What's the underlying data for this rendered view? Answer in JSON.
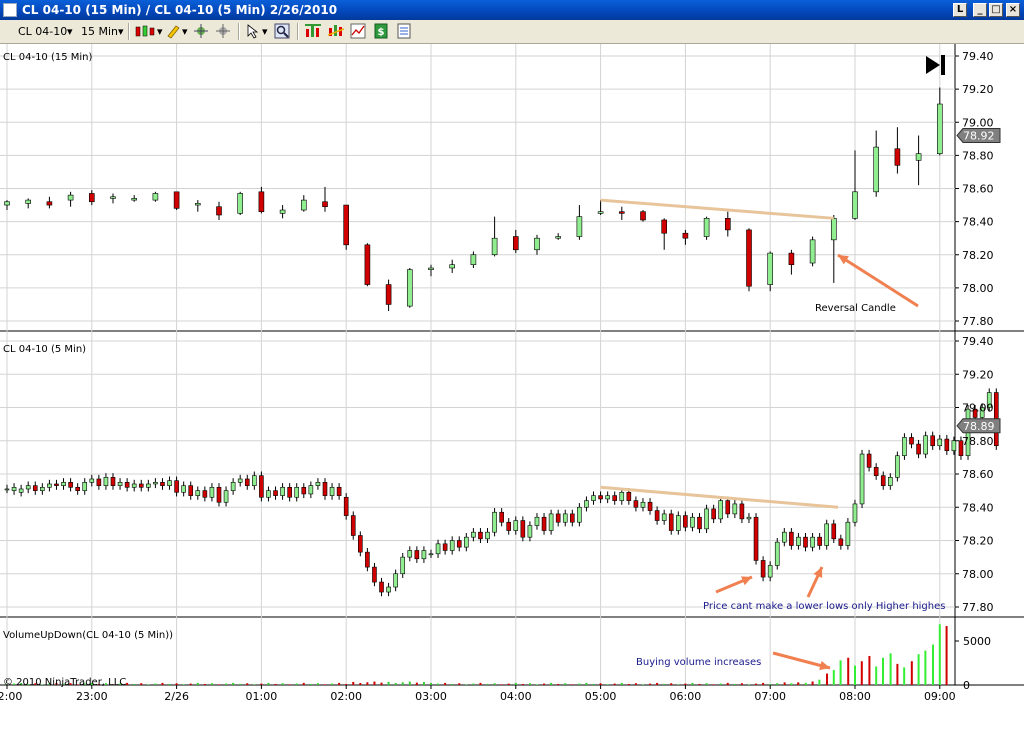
{
  "window": {
    "title": "CL 04-10 (15 Min) / CL 04-10 (5 Min)  2/26/2010",
    "buttons": [
      "L",
      "_",
      "□",
      "×"
    ]
  },
  "toolbar": {
    "instrument": "CL 04-10",
    "interval": "15 Min",
    "icons": [
      "candlestick-icon",
      "pencil-draw-icon",
      "crosshair-icon",
      "pointer-icon",
      "zoom-icon",
      "bar-chart-icon",
      "indicator-icon",
      "strategy-icon",
      "properties-icon"
    ]
  },
  "colors": {
    "up": "#90ee90",
    "down": "#d00000",
    "grid": "#d3d3d3",
    "trendline": "#e8c49a",
    "arrow": "#f08050",
    "annotation": "#1a1a8c",
    "price_marker_bg": "#808080"
  },
  "panels": {
    "p15": {
      "label": "CL 04-10 (15 Min)",
      "ylim": [
        77.75,
        79.45
      ],
      "ticks": [
        "79.40",
        "79.20",
        "79.00",
        "78.80",
        "78.60",
        "78.40",
        "78.20",
        "78.00",
        "77.80"
      ],
      "last_price": "78.92"
    },
    "p5": {
      "label": "CL 04-10 (5 Min)",
      "ylim": [
        77.75,
        79.45
      ],
      "ticks": [
        "79.40",
        "79.20",
        "79.00",
        "78.80",
        "78.60",
        "78.40",
        "78.20",
        "78.00",
        "77.80"
      ],
      "last_price": "78.89"
    },
    "vol": {
      "label": "VolumeUpDown(CL 04-10 (5 Min))",
      "ticks": [
        "5000",
        "0"
      ],
      "copyright": "© 2010 NinjaTrader, LLC"
    }
  },
  "time_axis": {
    "labels": [
      "2:00",
      "23:00",
      "2/26",
      "01:00",
      "02:00",
      "03:00",
      "04:00",
      "05:00",
      "06:00",
      "07:00",
      "08:00",
      "09:00"
    ],
    "hours": [
      -2,
      -1,
      0,
      1,
      2,
      3,
      4,
      5,
      6,
      7,
      8,
      9
    ]
  },
  "annotations": {
    "reversal": "Reversal Candle",
    "lower_lows": "Price cant make a lower lows only Higher highes",
    "volume": "Buying volume increases"
  },
  "chart_data": [
    {
      "type": "candlestick",
      "title": "CL 04-10 (15 Min)",
      "x_unit": "hours relative to 00:00 on 2/26 (x axis labels 2:00 ... 09:00)",
      "candles": [
        [
          -2.0,
          78.5,
          78.53,
          78.47,
          78.52
        ],
        [
          -1.75,
          78.51,
          78.54,
          78.48,
          78.53
        ],
        [
          -1.5,
          78.52,
          78.55,
          78.48,
          78.5
        ],
        [
          -1.25,
          78.53,
          78.58,
          78.49,
          78.56
        ],
        [
          -1.0,
          78.57,
          78.59,
          78.5,
          78.52
        ],
        [
          -0.75,
          78.54,
          78.57,
          78.51,
          78.55
        ],
        [
          -0.5,
          78.53,
          78.56,
          78.52,
          78.54
        ],
        [
          -0.25,
          78.53,
          78.58,
          78.52,
          78.57
        ],
        [
          0.0,
          78.58,
          78.58,
          78.47,
          78.48
        ],
        [
          0.25,
          78.5,
          78.53,
          78.46,
          78.51
        ],
        [
          0.5,
          78.49,
          78.52,
          78.41,
          78.44
        ],
        [
          0.75,
          78.45,
          78.58,
          78.44,
          78.57
        ],
        [
          1.0,
          78.58,
          78.61,
          78.45,
          78.46
        ],
        [
          1.25,
          78.45,
          78.5,
          78.42,
          78.47
        ],
        [
          1.5,
          78.47,
          78.56,
          78.46,
          78.53
        ],
        [
          1.75,
          78.52,
          78.61,
          78.46,
          78.49
        ],
        [
          2.0,
          78.5,
          78.5,
          78.23,
          78.26
        ],
        [
          2.25,
          78.26,
          78.27,
          78.01,
          78.02
        ],
        [
          2.5,
          78.02,
          78.05,
          77.86,
          77.9
        ],
        [
          2.75,
          77.89,
          78.12,
          77.88,
          78.11
        ],
        [
          3.0,
          78.11,
          78.14,
          78.07,
          78.12
        ],
        [
          3.25,
          78.12,
          78.17,
          78.09,
          78.14
        ],
        [
          3.5,
          78.14,
          78.22,
          78.12,
          78.2
        ],
        [
          3.75,
          78.2,
          78.43,
          78.19,
          78.3
        ],
        [
          4.0,
          78.31,
          78.35,
          78.21,
          78.23
        ],
        [
          4.25,
          78.23,
          78.32,
          78.2,
          78.3
        ],
        [
          4.5,
          78.3,
          78.33,
          78.29,
          78.31
        ],
        [
          4.75,
          78.31,
          78.5,
          78.29,
          78.43
        ],
        [
          5.0,
          78.45,
          78.53,
          78.44,
          78.46
        ],
        [
          5.25,
          78.46,
          78.49,
          78.41,
          78.45
        ],
        [
          5.5,
          78.46,
          78.47,
          78.4,
          78.41
        ],
        [
          5.75,
          78.41,
          78.42,
          78.23,
          78.33
        ],
        [
          6.0,
          78.33,
          78.35,
          78.26,
          78.3
        ],
        [
          6.25,
          78.31,
          78.43,
          78.29,
          78.42
        ],
        [
          6.5,
          78.42,
          78.46,
          78.31,
          78.35
        ],
        [
          6.75,
          78.35,
          78.36,
          77.98,
          78.01
        ],
        [
          7.0,
          78.02,
          78.22,
          77.98,
          78.21
        ],
        [
          7.25,
          78.21,
          78.23,
          78.08,
          78.14
        ],
        [
          7.5,
          78.15,
          78.31,
          78.13,
          78.29
        ],
        [
          7.75,
          78.29,
          78.44,
          78.03,
          78.42
        ],
        [
          8.0,
          78.42,
          78.83,
          78.41,
          78.58
        ],
        [
          8.25,
          78.58,
          78.95,
          78.55,
          78.85
        ],
        [
          8.5,
          78.84,
          78.97,
          78.69,
          78.74
        ],
        [
          8.75,
          78.77,
          78.92,
          78.62,
          78.81
        ],
        [
          9.0,
          78.81,
          79.21,
          78.8,
          79.11
        ]
      ]
    },
    {
      "type": "candlestick",
      "title": "CL 04-10 (5 Min)",
      "x_unit": "hours relative to 00:00 on 2/26",
      "start_hour": -2.0,
      "bar_hours": 0.08333,
      "candles_oc": [
        [
          78.51,
          78.51
        ],
        [
          78.5,
          78.52
        ],
        [
          78.49,
          78.51
        ],
        [
          78.51,
          78.53
        ],
        [
          78.53,
          78.5
        ],
        [
          78.5,
          78.52
        ],
        [
          78.52,
          78.54
        ],
        [
          78.54,
          78.53
        ],
        [
          78.53,
          78.55
        ],
        [
          78.55,
          78.52
        ],
        [
          78.52,
          78.5
        ],
        [
          78.5,
          78.55
        ],
        [
          78.55,
          78.57
        ],
        [
          78.57,
          78.53
        ],
        [
          78.53,
          78.58
        ],
        [
          78.58,
          78.53
        ],
        [
          78.53,
          78.55
        ],
        [
          78.55,
          78.52
        ],
        [
          78.52,
          78.54
        ],
        [
          78.54,
          78.52
        ],
        [
          78.52,
          78.54
        ],
        [
          78.54,
          78.55
        ],
        [
          78.55,
          78.53
        ],
        [
          78.53,
          78.56
        ],
        [
          78.56,
          78.49
        ],
        [
          78.49,
          78.53
        ],
        [
          78.53,
          78.47
        ],
        [
          78.47,
          78.5
        ],
        [
          78.5,
          78.46
        ],
        [
          78.46,
          78.52
        ],
        [
          78.52,
          78.43
        ],
        [
          78.43,
          78.5
        ],
        [
          78.5,
          78.55
        ],
        [
          78.55,
          78.57
        ],
        [
          78.57,
          78.53
        ],
        [
          78.53,
          78.59
        ],
        [
          78.59,
          78.46
        ],
        [
          78.46,
          78.5
        ],
        [
          78.5,
          78.47
        ],
        [
          78.47,
          78.52
        ],
        [
          78.52,
          78.46
        ],
        [
          78.46,
          78.52
        ],
        [
          78.52,
          78.48
        ],
        [
          78.48,
          78.53
        ],
        [
          78.53,
          78.55
        ],
        [
          78.55,
          78.47
        ],
        [
          78.47,
          78.52
        ],
        [
          78.52,
          78.47
        ],
        [
          78.46,
          78.35
        ],
        [
          78.35,
          78.23
        ],
        [
          78.23,
          78.13
        ],
        [
          78.13,
          78.04
        ],
        [
          78.04,
          77.95
        ],
        [
          77.95,
          77.89
        ],
        [
          77.89,
          77.92
        ],
        [
          77.92,
          78.0
        ],
        [
          78.0,
          78.1
        ],
        [
          78.1,
          78.14
        ],
        [
          78.14,
          78.09
        ],
        [
          78.09,
          78.14
        ],
        [
          78.12,
          78.12
        ],
        [
          78.12,
          78.18
        ],
        [
          78.18,
          78.14
        ],
        [
          78.14,
          78.2
        ],
        [
          78.2,
          78.16
        ],
        [
          78.16,
          78.22
        ],
        [
          78.22,
          78.25
        ],
        [
          78.25,
          78.21
        ],
        [
          78.21,
          78.25
        ],
        [
          78.25,
          78.37
        ],
        [
          78.37,
          78.31
        ],
        [
          78.31,
          78.26
        ],
        [
          78.26,
          78.32
        ],
        [
          78.32,
          78.22
        ],
        [
          78.22,
          78.29
        ],
        [
          78.29,
          78.34
        ],
        [
          78.34,
          78.26
        ],
        [
          78.26,
          78.36
        ],
        [
          78.36,
          78.31
        ],
        [
          78.31,
          78.36
        ],
        [
          78.36,
          78.31
        ],
        [
          78.31,
          78.4
        ],
        [
          78.4,
          78.44
        ],
        [
          78.44,
          78.47
        ],
        [
          78.47,
          78.45
        ],
        [
          78.45,
          78.47
        ],
        [
          78.47,
          78.44
        ],
        [
          78.44,
          78.49
        ],
        [
          78.49,
          78.44
        ],
        [
          78.44,
          78.4
        ],
        [
          78.4,
          78.43
        ],
        [
          78.43,
          78.38
        ],
        [
          78.38,
          78.32
        ],
        [
          78.32,
          78.36
        ],
        [
          78.36,
          78.26
        ],
        [
          78.26,
          78.35
        ],
        [
          78.35,
          78.28
        ],
        [
          78.28,
          78.34
        ],
        [
          78.34,
          78.27
        ],
        [
          78.27,
          78.39
        ],
        [
          78.39,
          78.33
        ],
        [
          78.33,
          78.44
        ],
        [
          78.44,
          78.36
        ],
        [
          78.36,
          78.42
        ],
        [
          78.42,
          78.33
        ],
        [
          78.33,
          78.34
        ],
        [
          78.34,
          78.08
        ],
        [
          78.08,
          77.98
        ],
        [
          77.98,
          78.05
        ],
        [
          78.05,
          78.19
        ],
        [
          78.19,
          78.25
        ],
        [
          78.25,
          78.17
        ],
        [
          78.17,
          78.22
        ],
        [
          78.22,
          78.16
        ],
        [
          78.16,
          78.22
        ],
        [
          78.22,
          78.17
        ],
        [
          78.17,
          78.3
        ],
        [
          78.3,
          78.21
        ],
        [
          78.21,
          78.17
        ],
        [
          78.17,
          78.31
        ],
        [
          78.31,
          78.42
        ],
        [
          78.42,
          78.72
        ],
        [
          78.72,
          78.64
        ],
        [
          78.64,
          78.59
        ],
        [
          78.59,
          78.53
        ],
        [
          78.53,
          78.58
        ],
        [
          78.58,
          78.71
        ],
        [
          78.71,
          78.82
        ],
        [
          78.82,
          78.78
        ],
        [
          78.78,
          78.72
        ],
        [
          78.72,
          78.83
        ],
        [
          78.83,
          78.77
        ],
        [
          78.77,
          78.81
        ],
        [
          78.81,
          78.74
        ],
        [
          78.74,
          78.8
        ],
        [
          78.8,
          78.71
        ],
        [
          78.71,
          78.99
        ],
        [
          78.99,
          78.94
        ],
        [
          78.94,
          79.0
        ],
        [
          79.0,
          79.09
        ],
        [
          79.09,
          78.77
        ]
      ]
    },
    {
      "type": "bar",
      "title": "VolumeUpDown(CL 04-10 (5 Min))",
      "ylim": [
        0,
        7000
      ],
      "recent_volumes": [
        [
          7.17,
          300,
          "down"
        ],
        [
          7.25,
          200,
          "up"
        ],
        [
          7.33,
          300,
          "down"
        ],
        [
          7.42,
          250,
          "up"
        ],
        [
          7.5,
          400,
          "down"
        ],
        [
          7.58,
          600,
          "up"
        ],
        [
          7.67,
          1300,
          "down"
        ],
        [
          7.75,
          1700,
          "up"
        ],
        [
          7.83,
          2800,
          "up"
        ],
        [
          7.92,
          3100,
          "down"
        ],
        [
          8.0,
          2200,
          "up"
        ],
        [
          8.08,
          2700,
          "down"
        ],
        [
          8.17,
          3300,
          "down"
        ],
        [
          8.25,
          2100,
          "up"
        ],
        [
          8.33,
          3100,
          "up"
        ],
        [
          8.42,
          3600,
          "up"
        ],
        [
          8.5,
          2400,
          "down"
        ],
        [
          8.58,
          2000,
          "up"
        ],
        [
          8.67,
          2700,
          "down"
        ],
        [
          8.75,
          3500,
          "up"
        ],
        [
          8.83,
          3900,
          "up"
        ],
        [
          8.92,
          4600,
          "up"
        ],
        [
          9.0,
          6900,
          "up"
        ],
        [
          9.08,
          6700,
          "down"
        ]
      ]
    }
  ]
}
